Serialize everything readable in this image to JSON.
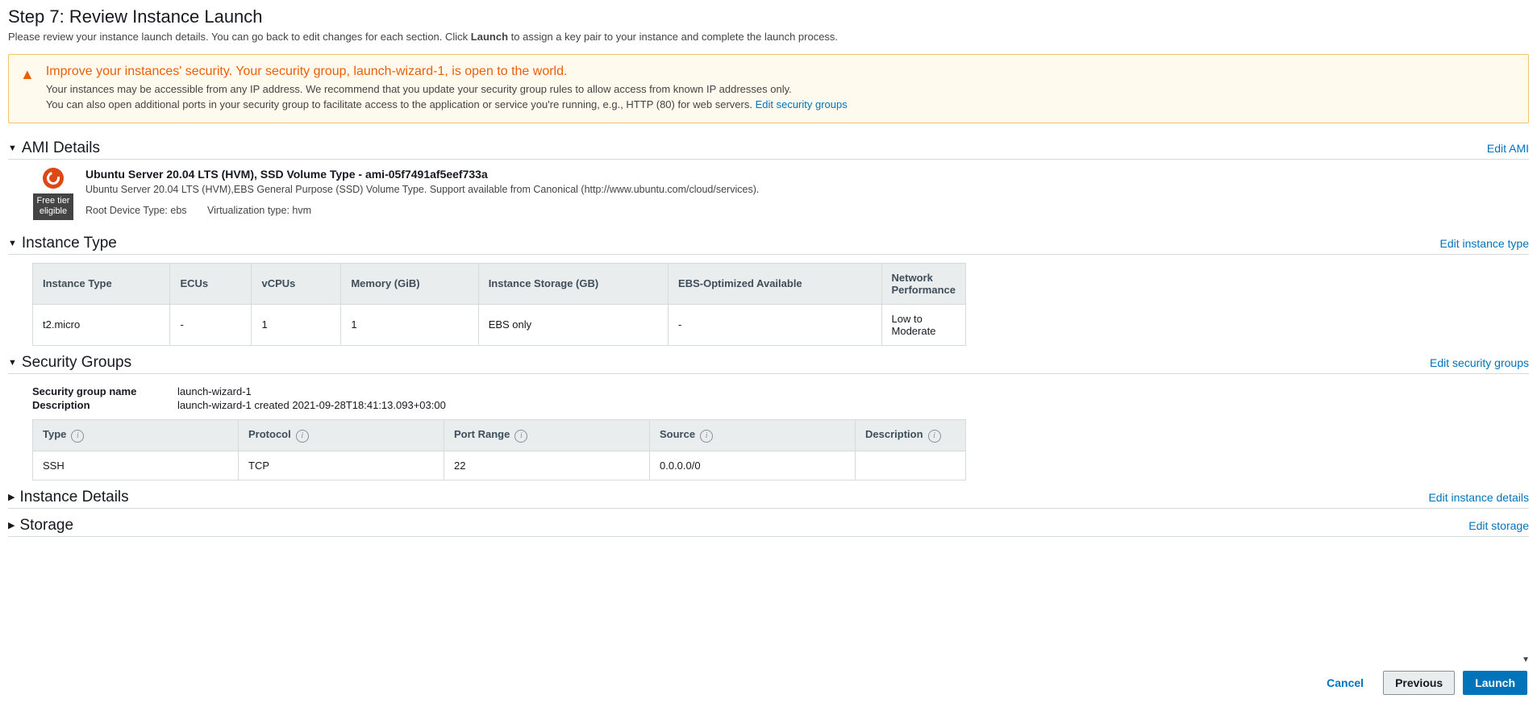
{
  "header": {
    "title": "Step 7: Review Instance Launch",
    "desc_pre": "Please review your instance launch details. You can go back to edit changes for each section. Click ",
    "desc_bold": "Launch",
    "desc_post": " to assign a key pair to your instance and complete the launch process."
  },
  "warning": {
    "title": "Improve your instances' security. Your security group, launch-wizard-1, is open to the world.",
    "line1": "Your instances may be accessible from any IP address. We recommend that you update your security group rules to allow access from known IP addresses only.",
    "line2": "You can also open additional ports in your security group to facilitate access to the application or service you're running, e.g., HTTP (80) for web servers.",
    "link": "Edit security groups"
  },
  "ami": {
    "section": "AMI Details",
    "edit": "Edit AMI",
    "tier_line1": "Free tier",
    "tier_line2": "eligible",
    "title": "Ubuntu Server 20.04 LTS (HVM), SSD Volume Type - ami-05f7491af5eef733a",
    "desc": "Ubuntu Server 20.04 LTS (HVM),EBS General Purpose (SSD) Volume Type. Support available from Canonical (http://www.ubuntu.com/cloud/services).",
    "root": "Root Device Type: ebs",
    "virt": "Virtualization type: hvm"
  },
  "instance_type": {
    "section": "Instance Type",
    "edit": "Edit instance type",
    "cols": [
      "Instance Type",
      "ECUs",
      "vCPUs",
      "Memory (GiB)",
      "Instance Storage (GB)",
      "EBS-Optimized Available",
      "Network Performance"
    ],
    "rows": [
      [
        "t2.micro",
        "-",
        "1",
        "1",
        "EBS only",
        "-",
        "Low to Moderate"
      ]
    ]
  },
  "security_groups": {
    "section": "Security Groups",
    "edit": "Edit security groups",
    "name_label": "Security group name",
    "name_value": "launch-wizard-1",
    "desc_label": "Description",
    "desc_value": "launch-wizard-1 created 2021-09-28T18:41:13.093+03:00",
    "cols": [
      "Type",
      "Protocol",
      "Port Range",
      "Source",
      "Description"
    ],
    "rows": [
      [
        "SSH",
        "TCP",
        "22",
        "0.0.0.0/0",
        ""
      ]
    ]
  },
  "instance_details": {
    "section": "Instance Details",
    "edit": "Edit instance details"
  },
  "storage": {
    "section": "Storage",
    "edit": "Edit storage"
  },
  "footer": {
    "cancel": "Cancel",
    "previous": "Previous",
    "launch": "Launch"
  }
}
